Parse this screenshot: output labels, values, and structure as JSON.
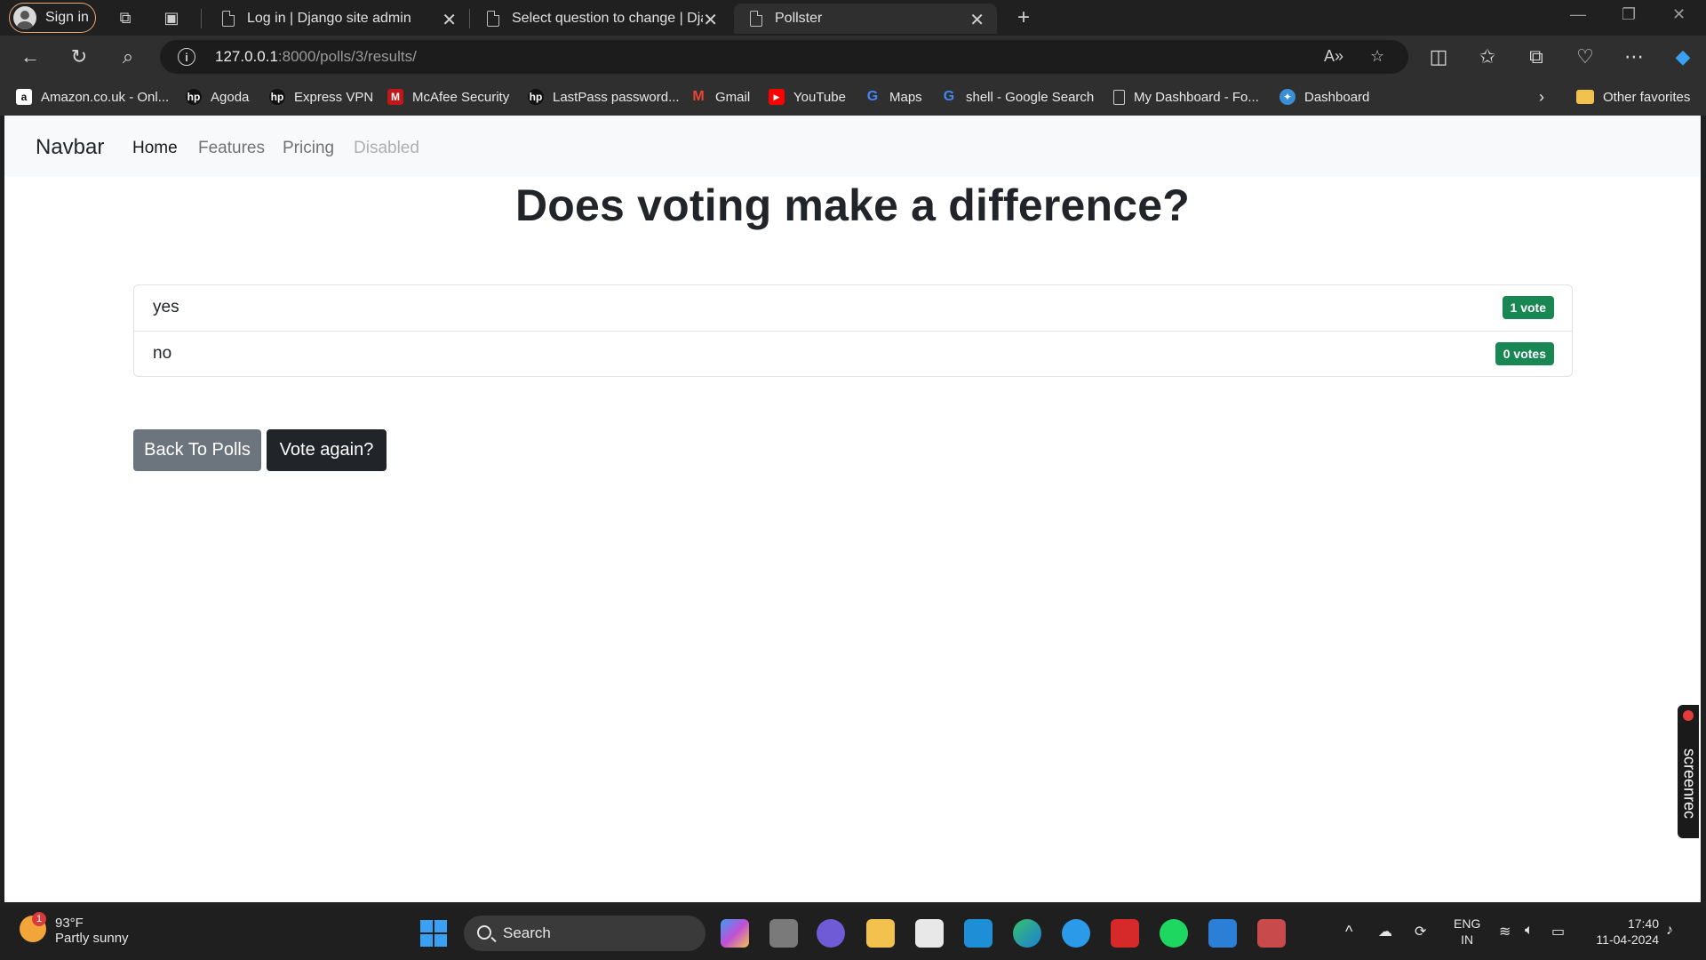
{
  "browser": {
    "signin_label": "Sign in",
    "tabs": [
      {
        "title": "Log in | Django site admin",
        "active": false
      },
      {
        "title": "Select question to change | Djan",
        "active": false
      },
      {
        "title": "Pollster",
        "active": true
      }
    ],
    "address": {
      "host": "127.0.0.1",
      "rest": ":8000/polls/3/results/"
    },
    "bookmarks": [
      {
        "label": "Amazon.co.uk - Onl...",
        "icon": "amazon-icon"
      },
      {
        "label": "Agoda",
        "icon": "hp-icon"
      },
      {
        "label": "Express VPN",
        "icon": "hp-icon"
      },
      {
        "label": "McAfee Security",
        "icon": "mcafee-icon"
      },
      {
        "label": "LastPass password...",
        "icon": "hp-icon"
      },
      {
        "label": "Gmail",
        "icon": "gmail-icon"
      },
      {
        "label": "YouTube",
        "icon": "youtube-icon"
      },
      {
        "label": "Maps",
        "icon": "google-icon"
      },
      {
        "label": "shell - Google Search",
        "icon": "google-icon"
      },
      {
        "label": "My Dashboard - Fo...",
        "icon": "page-icon"
      },
      {
        "label": "Dashboard",
        "icon": "globe-icon"
      }
    ],
    "other_favorites": "Other favorites"
  },
  "page": {
    "navbar": {
      "brand": "Navbar",
      "links": [
        {
          "label": "Home",
          "state": "active"
        },
        {
          "label": "Features",
          "state": "normal"
        },
        {
          "label": "Pricing",
          "state": "normal"
        },
        {
          "label": "Disabled",
          "state": "disabled"
        }
      ]
    },
    "question": "Does voting make a difference?",
    "choices": [
      {
        "label": "yes",
        "votes": "1 vote"
      },
      {
        "label": "no",
        "votes": "0 votes"
      }
    ],
    "buttons": {
      "back": "Back To Polls",
      "vote_again": "Vote again?"
    },
    "screenrec_label": "screenrec"
  },
  "taskbar": {
    "weather": {
      "temp": "93°F",
      "condition": "Partly sunny",
      "badge": "1"
    },
    "search_label": "Search",
    "lang": {
      "line1": "ENG",
      "line2": "IN"
    },
    "time": "17:40",
    "date": "11-04-2024"
  },
  "colors": {
    "badge_success": "#198754",
    "btn_secondary": "#6c757d",
    "btn_dark": "#212529"
  }
}
